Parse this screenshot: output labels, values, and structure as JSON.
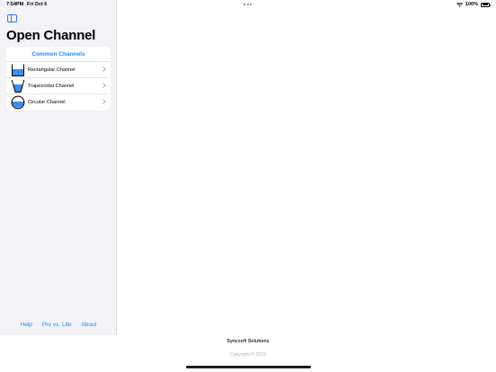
{
  "status_bar": {
    "time": "7:54PM",
    "date": "Fri Oct 6",
    "battery": "100%",
    "wifi_icon": "wifi-icon",
    "battery_icon": "battery-icon"
  },
  "sidebar": {
    "toggle_icon": "sidebar-toggle-icon",
    "title": "Open Channel",
    "section_header": "Common Channels",
    "channels": [
      {
        "label": "Rectangular Channel",
        "icon": "rectangular-channel-icon"
      },
      {
        "label": "Trapezoidal Channel",
        "icon": "trapezoidal-channel-icon"
      },
      {
        "label": "Circular Channel",
        "icon": "circular-channel-icon"
      }
    ],
    "footer_links": [
      "Help",
      "Pro vs. Lite",
      "About"
    ]
  },
  "footer": {
    "company": "Syncsoft Solutions",
    "copyright": "Copyright © 2023"
  },
  "colors": {
    "accent": "#1a8cff",
    "water": "#3d8de6",
    "sidebar_bg": "#f2f2f7"
  }
}
